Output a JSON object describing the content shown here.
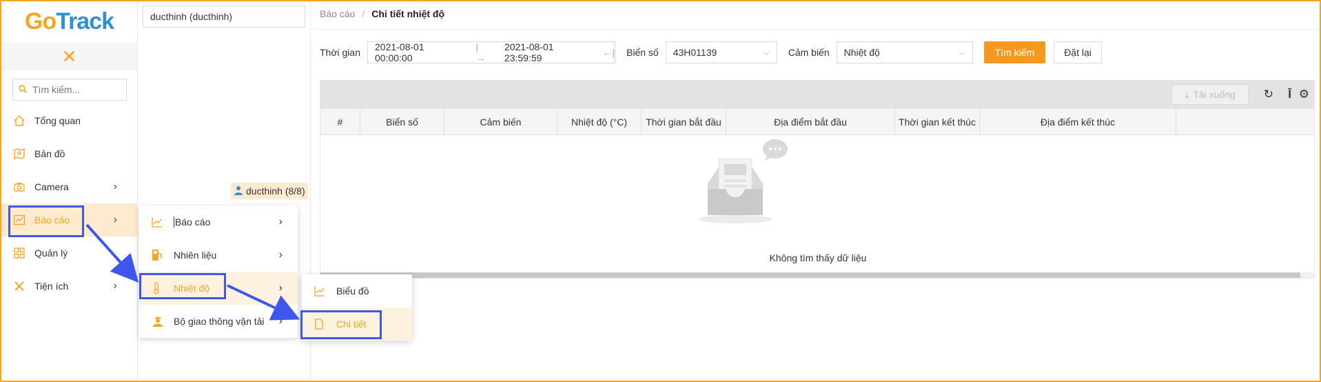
{
  "app": {
    "logo_prefix": "Go",
    "logo_rest": "Track"
  },
  "sidebar": {
    "search_placeholder": "Tìm kiếm...",
    "items": [
      {
        "label": "Tổng quan",
        "icon": "home-icon"
      },
      {
        "label": "Bản đồ",
        "icon": "map-icon"
      },
      {
        "label": "Camera",
        "icon": "camera-icon"
      },
      {
        "label": "Báo cáo",
        "icon": "chart-icon"
      },
      {
        "label": "Quản lý",
        "icon": "grid-icon"
      },
      {
        "label": "Tiện ích",
        "icon": "tools-icon"
      }
    ]
  },
  "tree": {
    "account_select": "ducthinh (ducthinh)",
    "user_node": "ducthinh (8/8)"
  },
  "menu_reports": {
    "items": [
      {
        "label": "Báo cáo"
      },
      {
        "label": "Nhiên liệu"
      },
      {
        "label": "Nhiệt độ"
      },
      {
        "label": "Bộ giao thông vận tải"
      }
    ]
  },
  "menu_temperature": {
    "items": [
      {
        "label": "Biểu đồ"
      },
      {
        "label": "Chi tiết"
      }
    ]
  },
  "breadcrumb": {
    "parent": "Báo cáo",
    "current": "Chi tiết nhiệt độ"
  },
  "filters": {
    "time_label": "Thời gian",
    "start": "2021-08-01 00:00:00",
    "end": "2021-08-01 23:59:59",
    "plate_label": "Biển số",
    "plate_value": "43H01139",
    "sensor_label": "Cảm biến",
    "sensor_value": "Nhiệt độ",
    "search_button": "Tìm kiếm",
    "reset_button": "Đặt lại"
  },
  "toolbar": {
    "download_label": "Tải xuống"
  },
  "table": {
    "columns": [
      "#",
      "Biển số",
      "Cảm biến",
      "Nhiệt độ (°C)",
      "Thời gian bắt đầu",
      "Địa điểm bắt đầu",
      "Thời gian kết thúc",
      "Địa điểm kết thúc"
    ],
    "empty_text": "Không tìm thấy dữ liệu"
  },
  "colors": {
    "accent": "#f39a1e",
    "highlight": "#3d56f0",
    "brand_blue": "#2f8fd8"
  }
}
